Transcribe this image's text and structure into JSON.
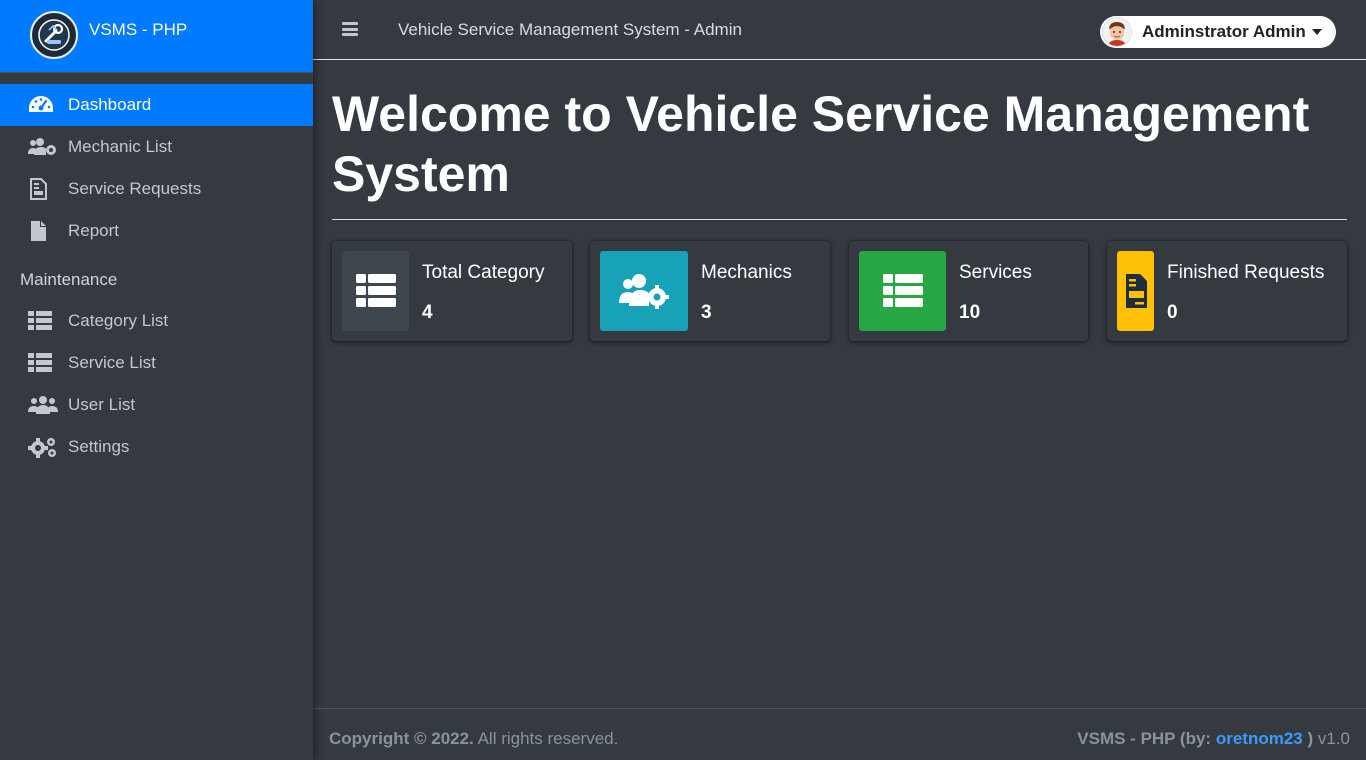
{
  "brand": {
    "name": "VSMS - PHP",
    "icon": "car-repair-logo"
  },
  "topbar": {
    "title": "Vehicle Service Management System - Admin",
    "user_name": "Adminstrator Admin"
  },
  "sidebar": {
    "items": [
      {
        "label": "Dashboard",
        "icon": "tachometer-icon",
        "active": true
      },
      {
        "label": "Mechanic List",
        "icon": "users-cog-icon"
      },
      {
        "label": "Service Requests",
        "icon": "file-invoice-icon"
      },
      {
        "label": "Report",
        "icon": "file-icon"
      }
    ],
    "section_header": "Maintenance",
    "maintenance_items": [
      {
        "label": "Category List",
        "icon": "th-list-icon"
      },
      {
        "label": "Service List",
        "icon": "th-list-icon"
      },
      {
        "label": "User List",
        "icon": "users-icon"
      },
      {
        "label": "Settings",
        "icon": "cogs-icon"
      }
    ]
  },
  "main": {
    "title": "Welcome to Vehicle Service Management System",
    "cards": [
      {
        "label": "Total Category",
        "value": "4",
        "color": "#3f474e",
        "icon": "th-list-icon"
      },
      {
        "label": "Mechanics",
        "value": "3",
        "color": "#17a2b8",
        "icon": "users-cog-icon"
      },
      {
        "label": "Services",
        "value": "10",
        "color": "#28a745",
        "icon": "th-list-icon"
      },
      {
        "label": "Finished Requests",
        "value": "0",
        "color": "#ffc107",
        "icon": "file-invoice-icon"
      }
    ]
  },
  "footer": {
    "copyright_bold": "Copyright © 2022.",
    "copyright_rest": " All rights reserved.",
    "app_prefix": "VSMS - PHP (by: ",
    "author": "oretnom23",
    "app_suffix": " )",
    "version": " v1.0"
  },
  "colors": {
    "accent": "#007bff",
    "bg": "#343a40",
    "sidebar_text": "#c2c7d0"
  }
}
